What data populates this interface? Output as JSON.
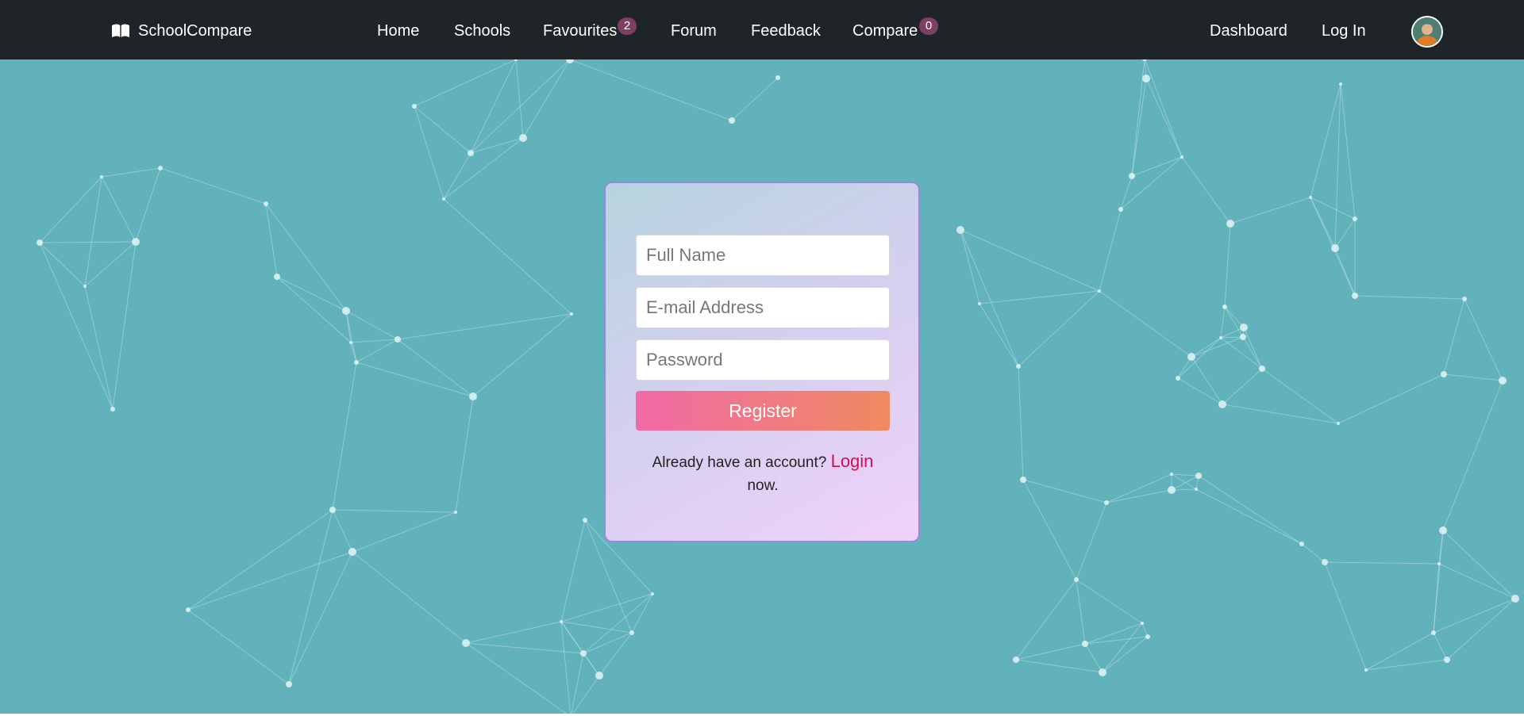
{
  "nav": {
    "brand": "SchoolCompare",
    "links": {
      "home": "Home",
      "schools": "Schools",
      "favourites": "Favourites",
      "forum": "Forum",
      "feedback": "Feedback",
      "compare": "Compare",
      "dashboard": "Dashboard",
      "login": "Log In"
    },
    "badges": {
      "favourites": "2",
      "compare": "0"
    }
  },
  "form": {
    "full_name_placeholder": "Full Name",
    "email_placeholder": "E-mail Address",
    "password_placeholder": "Password",
    "register_label": "Register",
    "prompt_before": "Already have an account?",
    "login_link": "Login",
    "prompt_after": "now."
  },
  "colors": {
    "navbar": "#1f2428",
    "background": "#62b2bb",
    "badge": "#7d3f63",
    "button_start": "#f16aa8",
    "button_end": "#ef8a5f",
    "login_link": "#d0104f"
  },
  "icons": {
    "brand": "open-book-icon",
    "avatar": "user-avatar"
  }
}
